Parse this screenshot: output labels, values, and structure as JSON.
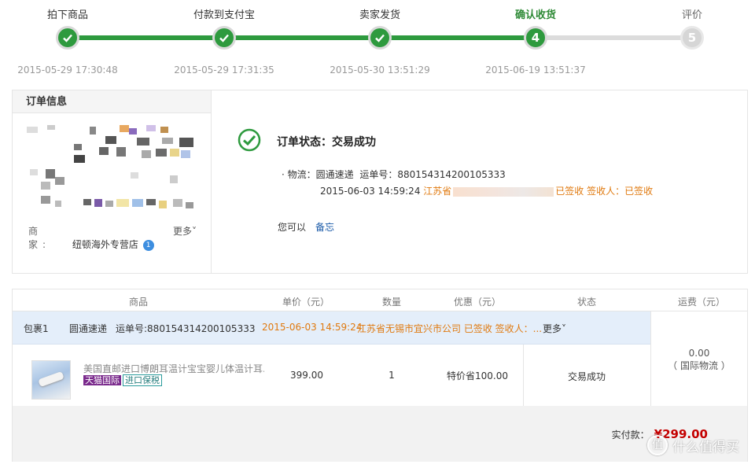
{
  "progress": {
    "steps": [
      {
        "label": "拍下商品",
        "mark": "✓",
        "time": "2015-05-29 17:30:48"
      },
      {
        "label": "付款到支付宝",
        "mark": "✓",
        "time": "2015-05-29 17:31:35"
      },
      {
        "label": "卖家发货",
        "mark": "✓",
        "time": "2015-05-30 13:51:29"
      },
      {
        "label": "确认收货",
        "mark": "4",
        "time": "2015-06-19 13:51:37"
      },
      {
        "label": "评价",
        "mark": "5",
        "time": ""
      }
    ],
    "colors": {
      "done": "#2e9a3e",
      "todo": "#dcdcdc",
      "current_label": "#2e8a36"
    }
  },
  "order_info": {
    "title": "订单信息",
    "seller_key": "商　家:",
    "seller_name": "纽顿海外专营店",
    "seller_badge": "1",
    "more": "更多˅"
  },
  "status": {
    "text": "订单状态：交易成功",
    "icon": "check-circle-icon",
    "logistics": {
      "bullet": "·",
      "company_label": "物流：",
      "company": "圆通速递",
      "waybill_label": "运单号：",
      "waybill": "880154314200105333",
      "time": "2015-06-03 14:59:24",
      "location_prefix": "江苏省",
      "signed": "已签收",
      "receiver": "签收人：已签收"
    },
    "can_do": "您可以",
    "memo_link": "备忘"
  },
  "goods_table": {
    "headers": [
      "商品",
      "单价（元）",
      "数量",
      "优惠（元）",
      "状态",
      "运费（元）"
    ],
    "package": {
      "label": "包裹1",
      "courier": "圆通速递",
      "waybill": "运单号:880154314200105333",
      "time": "2015-06-03 14:59:24",
      "trace": "江苏省无锡市宜兴市公司 已签收 签收人：...",
      "more": "更多˅"
    },
    "item": {
      "name": "美国直邮进口博朗耳温计宝宝婴儿体温计耳...",
      "tag1": "天猫国际",
      "tag2": "进口保税",
      "price": "399.00",
      "qty": "1",
      "discount": "特价省100.00",
      "status": "交易成功"
    },
    "shipping_fee": "0.00",
    "shipping_type": "（ 国际物流 ）",
    "pay_label": "实付款：",
    "pay_amount": "¥299.00",
    "pay_color": "#c40000"
  },
  "watermark": {
    "text": "什么值得买",
    "logo": "值"
  }
}
